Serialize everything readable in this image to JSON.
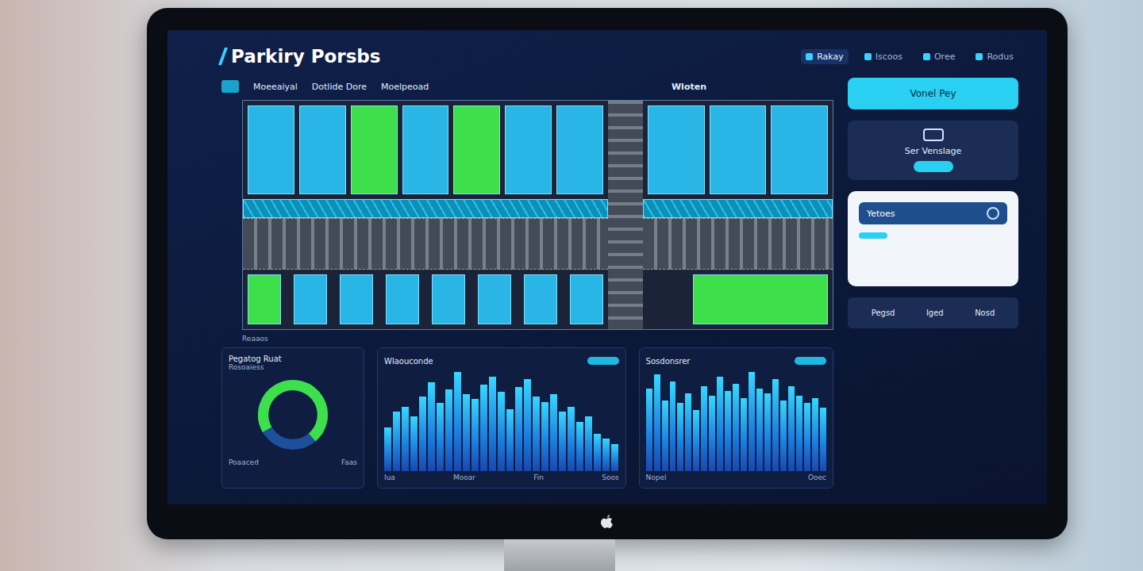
{
  "window": {
    "title": "Parkiry Porsbs"
  },
  "nav": [
    {
      "label": "Rakay",
      "selected": true
    },
    {
      "label": "Iscoos",
      "selected": false
    },
    {
      "label": "Oree",
      "selected": false
    },
    {
      "label": "Rodus",
      "selected": false
    }
  ],
  "toolbar": [
    {
      "label": "Moeeaiyal"
    },
    {
      "label": "Dotlide Dore"
    },
    {
      "label": "Moelpeoad"
    }
  ],
  "map": {
    "label": "Wloten",
    "legend": "Reaaos",
    "top_left": [
      {
        "color": "#29b6e6"
      },
      {
        "color": "#29b6e6"
      },
      {
        "color": "#3de04a"
      },
      {
        "color": "#29b6e6"
      },
      {
        "color": "#3de04a"
      },
      {
        "color": "#29b6e6"
      },
      {
        "color": "#29b6e6"
      }
    ],
    "top_right": [
      {
        "color": "#29b6e6"
      },
      {
        "color": "#29b6e6"
      },
      {
        "color": "#29b6e6"
      }
    ],
    "bottom_left": [
      {
        "color": "#3de04a"
      },
      {
        "color": "#29b6e6"
      },
      {
        "color": "#29b6e6"
      },
      {
        "color": "#29b6e6"
      },
      {
        "color": "#29b6e6"
      },
      {
        "color": "#29b6e6"
      },
      {
        "color": "#29b6e6"
      },
      {
        "color": "#29b6e6"
      }
    ],
    "bottom_right": [
      {
        "color": "#3de04a"
      }
    ]
  },
  "side": {
    "button": "Vonel Pey",
    "card_title": "Ser Venslage",
    "info_title": "Yetoes",
    "actions": [
      "Pegsd",
      "Iged",
      "Nosd"
    ]
  },
  "gauge": {
    "title": "Pegatog Ruat",
    "subtitle": "Rosoaiess",
    "level": 0.72,
    "labels": [
      "Poaaced",
      "Faas"
    ]
  },
  "charts": [
    {
      "title": "Wlaouconde",
      "values": [
        35,
        48,
        52,
        44,
        60,
        72,
        55,
        66,
        80,
        62,
        58,
        70,
        76,
        64,
        50,
        68,
        74,
        60,
        56,
        62,
        48,
        52,
        40,
        44,
        30,
        26,
        22
      ],
      "ticks": [
        "Iua",
        "Mooar",
        "Fin",
        "Soos"
      ]
    },
    {
      "title": "Sosdonsrer",
      "values": [
        70,
        82,
        60,
        76,
        58,
        66,
        52,
        72,
        64,
        80,
        68,
        74,
        62,
        84,
        70,
        66,
        78,
        60,
        72,
        64,
        58,
        62,
        54
      ],
      "ticks": [
        "Nopel",
        "Ooec"
      ]
    }
  ]
}
